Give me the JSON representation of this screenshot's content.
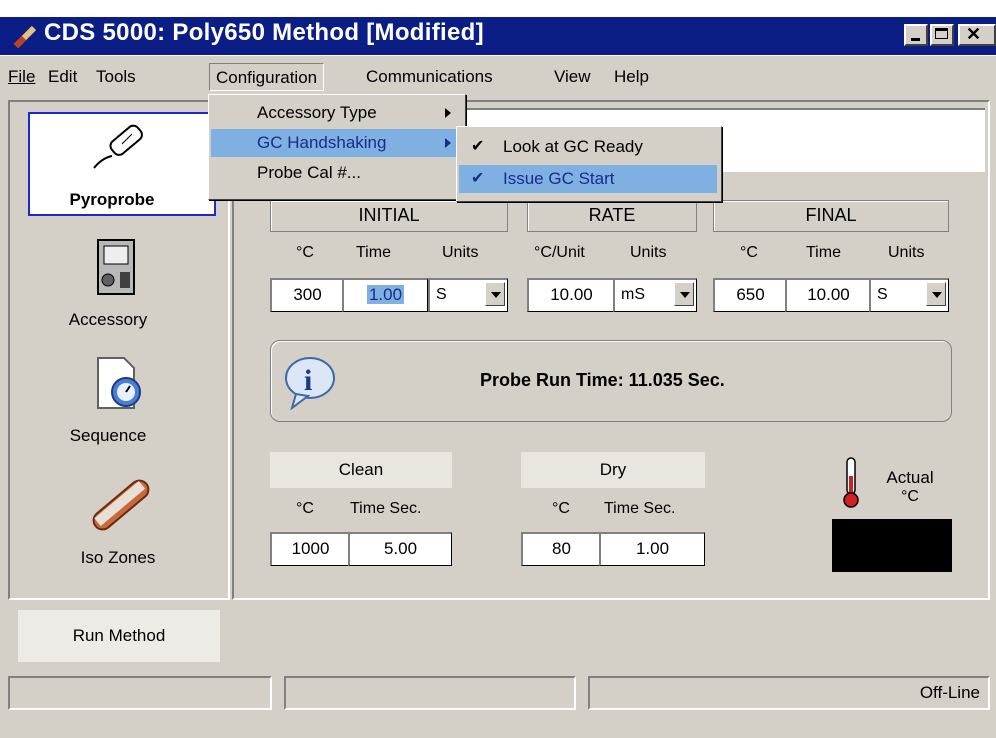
{
  "window": {
    "title": "CDS 5000: Poly650 Method [Modified]"
  },
  "menubar": [
    "File",
    "Edit",
    "Tools",
    "Configuration",
    "Communications",
    "View",
    "Help"
  ],
  "config_menu": [
    "Accessory Type",
    "GC Handshaking",
    "Probe Cal #..."
  ],
  "handshake_submenu": [
    {
      "label": "Look at GC Ready",
      "checked": true
    },
    {
      "label": "Issue GC Start",
      "checked": true
    }
  ],
  "nav": [
    "Pyroprobe",
    "Accessory",
    "Sequence",
    "Iso Zones"
  ],
  "sections": {
    "initial": "INITIAL",
    "rate": "RATE",
    "final": "FINAL"
  },
  "initial": {
    "col_c": "°C",
    "col_time": "Time",
    "col_units": "Units",
    "temp": "300",
    "time": "1.00",
    "units": "S"
  },
  "rate": {
    "col_cunit": "°C/Unit",
    "col_units": "Units",
    "value": "10.00",
    "units": "mS"
  },
  "final": {
    "col_c": "°C",
    "col_time": "Time",
    "col_units": "Units",
    "temp": "650",
    "time": "10.00",
    "units": "S"
  },
  "info": {
    "run_time": "Probe Run Time: 11.035 Sec."
  },
  "clean": {
    "title": "Clean",
    "col_c": "°C",
    "col_time": "Time Sec.",
    "temp": "1000",
    "time": "5.00"
  },
  "dry": {
    "title": "Dry",
    "col_c": "°C",
    "col_time": "Time Sec.",
    "temp": "80",
    "time": "1.00"
  },
  "actual": {
    "label_top": "Actual",
    "label_unit": "°C"
  },
  "run_button": "Run Method",
  "status": {
    "right": "Off-Line"
  }
}
